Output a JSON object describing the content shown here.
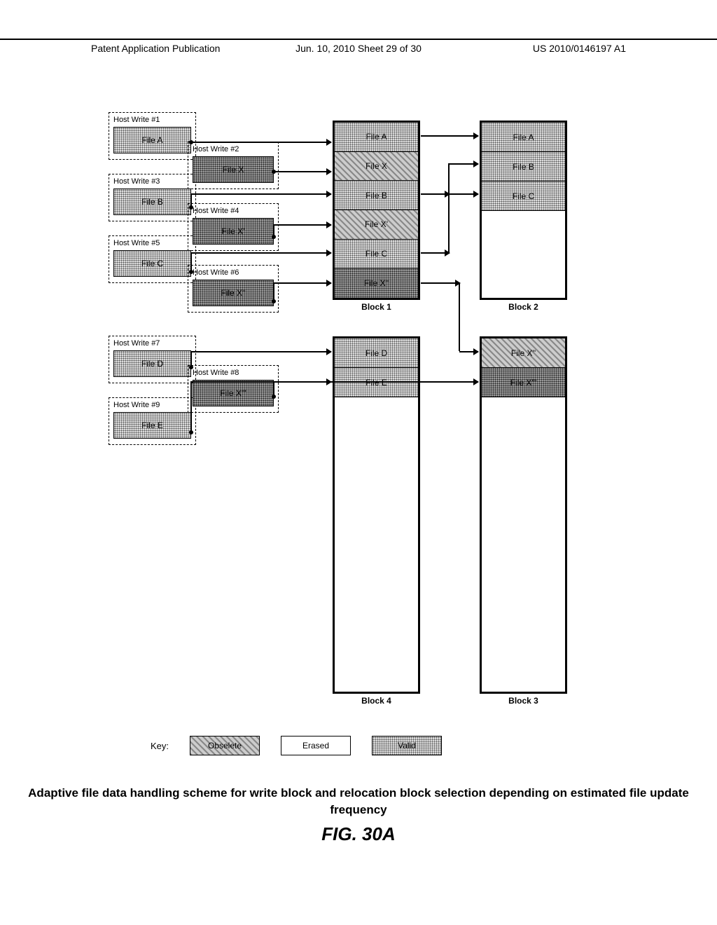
{
  "header": {
    "left": "Patent Application Publication",
    "center": "Jun. 10, 2010  Sheet 29 of 30",
    "right": "US 2010/0146197 A1"
  },
  "host_writes_left": [
    {
      "label": "Host Write #1",
      "file": "File A"
    },
    {
      "label": "Host Write #3",
      "file": "File B"
    },
    {
      "label": "Host Write #5",
      "file": "File C"
    },
    {
      "label": "Host Write #7",
      "file": "File D"
    },
    {
      "label": "Host Write #9",
      "file": "File E"
    }
  ],
  "host_writes_right": [
    {
      "label": "Host Write #2",
      "file": "File X"
    },
    {
      "label": "Host Write #4",
      "file": "File X'"
    },
    {
      "label": "Host Write #6",
      "file": "File X''"
    },
    {
      "label": "Host Write #8",
      "file": "File X'''"
    }
  ],
  "blocks": {
    "block1": {
      "label": "Block 1",
      "slots": [
        {
          "text": "File A",
          "state": "valid"
        },
        {
          "text": "File X",
          "state": "obsolete"
        },
        {
          "text": "File B",
          "state": "valid"
        },
        {
          "text": "File X'",
          "state": "obsolete"
        },
        {
          "text": "File C",
          "state": "valid"
        },
        {
          "text": "File X''",
          "state": "valid-dark"
        }
      ]
    },
    "block2": {
      "label": "Block 2",
      "slots": [
        {
          "text": "File A",
          "state": "valid"
        },
        {
          "text": "File B",
          "state": "valid"
        },
        {
          "text": "File C",
          "state": "valid"
        }
      ]
    },
    "block3": {
      "label": "Block 3",
      "slots": [
        {
          "text": "File X''",
          "state": "obsolete"
        },
        {
          "text": "File X'''",
          "state": "valid-dark"
        }
      ]
    },
    "block4": {
      "label": "Block 4",
      "slots": [
        {
          "text": "File D",
          "state": "valid"
        },
        {
          "text": "File E",
          "state": "valid"
        }
      ]
    }
  },
  "key": {
    "label": "Key:",
    "items": [
      {
        "text": "Obselete",
        "state": "obsolete"
      },
      {
        "text": "Erased",
        "state": "erased"
      },
      {
        "text": "Valid",
        "state": "valid"
      }
    ]
  },
  "caption": "Adaptive file data handling scheme for write block and relocation block selection depending on estimated file update frequency",
  "fig_label": "FIG. 30A"
}
